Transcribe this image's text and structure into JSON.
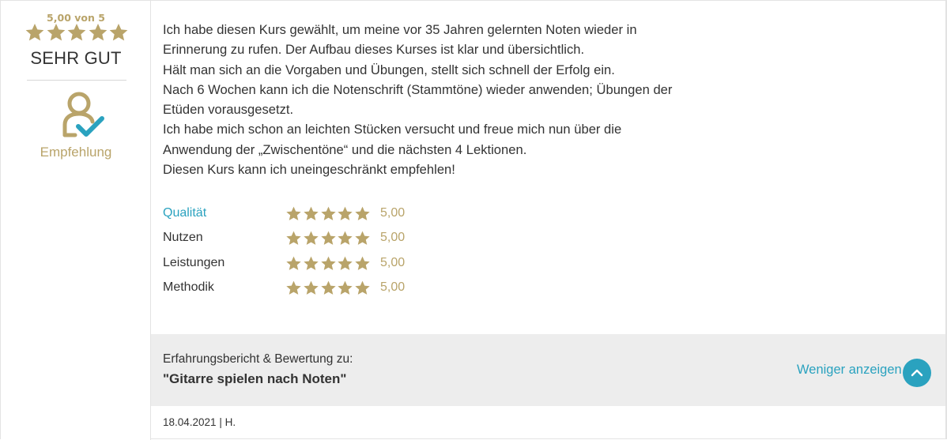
{
  "rating_summary": {
    "score_text": "5,00 von 5",
    "stars": 5,
    "verdict": "SEHR GUT",
    "recommendation_label": "Empfehlung"
  },
  "review": {
    "lines": [
      "Ich habe diesen Kurs gewählt, um meine vor 35 Jahren gelernten Noten wieder in",
      "Erinnerung zu rufen. Der Aufbau dieses Kurses ist klar und übersichtlich.",
      "Hält man sich an die Vorgaben und Übungen, stellt sich schnell der Erfolg ein.",
      "Nach 6 Wochen kann ich die Notenschrift (Stammtöne) wieder anwenden; Übungen der",
      "Etüden vorausgesetzt.",
      "Ich habe mich schon an leichten Stücken versucht und freue mich nun über die",
      "Anwendung der „Zwischentöne“ und die nächsten 4 Lektionen.",
      "Diesen Kurs kann ich uneingeschränkt empfehlen!"
    ]
  },
  "criteria": [
    {
      "label": "Qualität",
      "stars": 5,
      "value": "5,00"
    },
    {
      "label": "Nutzen",
      "stars": 5,
      "value": "5,00"
    },
    {
      "label": "Leistungen",
      "stars": 5,
      "value": "5,00"
    },
    {
      "label": "Methodik",
      "stars": 5,
      "value": "5,00"
    }
  ],
  "footer": {
    "caption": "Erfahrungsbericht & Bewertung zu:",
    "course": "\"Gitarre spielen nach Noten\"",
    "less_link": "Weniger anzeigen"
  },
  "meta": {
    "date_author": "18.04.2021 | H."
  },
  "colors": {
    "gold": "#b9a46a",
    "teal": "#2aa2bf",
    "band": "#ededed"
  }
}
